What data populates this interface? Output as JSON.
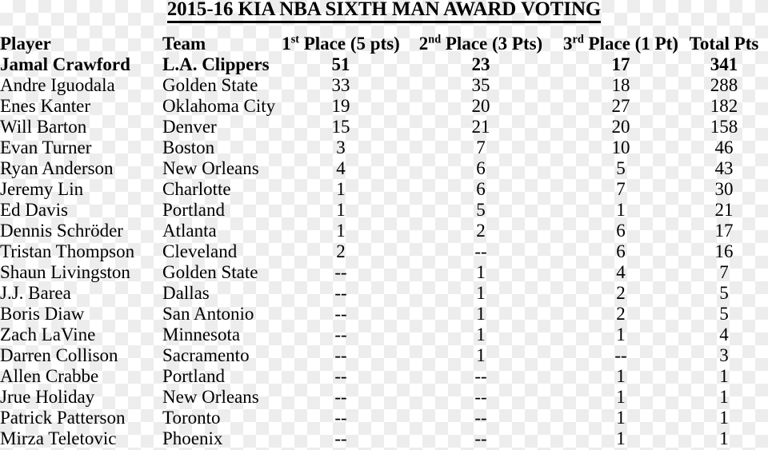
{
  "title": "2015-16 KIA NBA SIXTH MAN AWARD VOTING",
  "table": {
    "headers": {
      "player": "Player",
      "team": "Team",
      "first_place_prefix": "1",
      "first_place_ordinal": "st",
      "first_place_rest": " Place (5 pts)",
      "second_place_prefix": "2",
      "second_place_ordinal": "nd",
      "second_place_rest": " Place (3 Pts)",
      "third_place_prefix": "3",
      "third_place_ordinal": "rd",
      "third_place_rest": " Place (1 Pt)",
      "total": "Total Pts"
    },
    "rows": [
      {
        "player": "Jamal Crawford",
        "team": "L.A. Clippers",
        "first": "51",
        "second": "23",
        "third": "17",
        "total": "341"
      },
      {
        "player": "Andre Iguodala",
        "team": "Golden State",
        "first": "33",
        "second": "35",
        "third": "18",
        "total": "288"
      },
      {
        "player": "Enes Kanter",
        "team": "Oklahoma City",
        "first": "19",
        "second": "20",
        "third": "27",
        "total": "182"
      },
      {
        "player": "Will Barton",
        "team": "Denver",
        "first": "15",
        "second": "21",
        "third": "20",
        "total": "158"
      },
      {
        "player": "Evan Turner",
        "team": "Boston",
        "first": "3",
        "second": "7",
        "third": "10",
        "total": "46"
      },
      {
        "player": "Ryan Anderson",
        "team": "New Orleans",
        "first": "4",
        "second": "6",
        "third": "5",
        "total": "43"
      },
      {
        "player": "Jeremy Lin",
        "team": "Charlotte",
        "first": "1",
        "second": "6",
        "third": "7",
        "total": "30"
      },
      {
        "player": "Ed Davis",
        "team": "Portland",
        "first": "1",
        "second": "5",
        "third": "1",
        "total": "21"
      },
      {
        "player": "Dennis Schröder",
        "team": "Atlanta",
        "first": "1",
        "second": "2",
        "third": "6",
        "total": "17"
      },
      {
        "player": "Tristan Thompson",
        "team": "Cleveland",
        "first": "2",
        "second": "--",
        "third": "6",
        "total": "16"
      },
      {
        "player": "Shaun Livingston",
        "team": "Golden State",
        "first": "--",
        "second": "1",
        "third": "4",
        "total": "7"
      },
      {
        "player": "J.J. Barea",
        "team": "Dallas",
        "first": "--",
        "second": "1",
        "third": "2",
        "total": "5"
      },
      {
        "player": "Boris Diaw",
        "team": "San Antonio",
        "first": "--",
        "second": "1",
        "third": "2",
        "total": "5"
      },
      {
        "player": "Zach LaVine",
        "team": "Minnesota",
        "first": "--",
        "second": "1",
        "third": "1",
        "total": "4"
      },
      {
        "player": "Darren Collison",
        "team": "Sacramento",
        "first": "--",
        "second": "1",
        "third": "--",
        "total": "3"
      },
      {
        "player": "Allen Crabbe",
        "team": "Portland",
        "first": "--",
        "second": "--",
        "third": "1",
        "total": "1"
      },
      {
        "player": "Jrue Holiday",
        "team": "New Orleans",
        "first": "--",
        "second": "--",
        "third": "1",
        "total": "1"
      },
      {
        "player": "Patrick Patterson",
        "team": "Toronto",
        "first": "--",
        "second": "--",
        "third": "1",
        "total": "1"
      },
      {
        "player": "Mirza Teletovic",
        "team": "Phoenix",
        "first": "--",
        "second": "--",
        "third": "1",
        "total": "1"
      }
    ]
  }
}
